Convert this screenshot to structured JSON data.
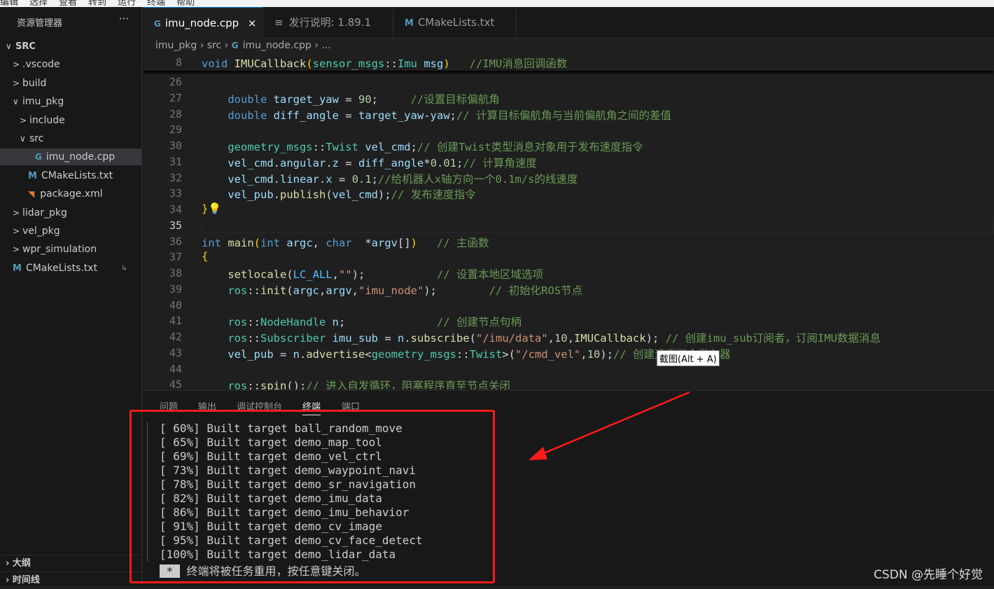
{
  "menu": [
    "编辑",
    "选择",
    "查看",
    "转到",
    "运行",
    "终端",
    "帮助"
  ],
  "sidebar": {
    "title": "资源管理器",
    "more": "···",
    "items": [
      {
        "label": "SRC",
        "depth": 0,
        "type": "root",
        "chev": "∨"
      },
      {
        "label": ".vscode",
        "depth": 1,
        "chev": ">"
      },
      {
        "label": "build",
        "depth": 1,
        "chev": ">"
      },
      {
        "label": "imu_pkg",
        "depth": 1,
        "chev": "∨"
      },
      {
        "label": "include",
        "depth": 2,
        "chev": ">"
      },
      {
        "label": "src",
        "depth": 2,
        "chev": "∨"
      },
      {
        "label": "imu_node.cpp",
        "depth": 3,
        "icon": "cpp",
        "selected": true
      },
      {
        "label": "CMakeLists.txt",
        "depth": 2,
        "icon": "cmake"
      },
      {
        "label": "package.xml",
        "depth": 2,
        "icon": "rss"
      },
      {
        "label": "lidar_pkg",
        "depth": 1,
        "chev": ">"
      },
      {
        "label": "vel_pkg",
        "depth": 1,
        "chev": ">"
      },
      {
        "label": "wpr_simulation",
        "depth": 1,
        "chev": ">"
      },
      {
        "label": "CMakeLists.txt",
        "depth": 1,
        "icon": "cmake",
        "link": "↳"
      }
    ],
    "outline": "大纲",
    "timeline": "时间线"
  },
  "tabs": [
    {
      "label": "imu_node.cpp",
      "icon": "cpp",
      "close": "×",
      "active": true
    },
    {
      "label": "发行说明: 1.89.1",
      "icon": "doc"
    },
    {
      "label": "CMakeLists.txt",
      "icon": "cmake"
    }
  ],
  "breadcrumb": [
    "imu_pkg",
    "src",
    "imu_node.cpp",
    "..."
  ],
  "editor": {
    "sticky": {
      "ln": "8",
      "seg": [
        [
          "void ",
          "k"
        ],
        [
          "IMUCallback",
          "f"
        ],
        [
          "(",
          "p"
        ],
        [
          "sensor_msgs",
          "t"
        ],
        [
          "::",
          "o"
        ],
        [
          "Imu",
          "t"
        ],
        [
          " msg",
          "v"
        ],
        [
          ")",
          "p"
        ],
        [
          "   //IMU消息回调函数",
          "c"
        ]
      ]
    },
    "lines": [
      {
        "ln": "26",
        "seg": []
      },
      {
        "ln": "27",
        "seg": [
          [
            "    double ",
            "k"
          ],
          [
            "target_yaw",
            "v"
          ],
          [
            " = ",
            "o"
          ],
          [
            "90",
            "n"
          ],
          [
            ";     ",
            "o"
          ],
          [
            "//设置目标偏航角",
            "c"
          ]
        ]
      },
      {
        "ln": "28",
        "seg": [
          [
            "    double ",
            "k"
          ],
          [
            "diff_angle",
            "v"
          ],
          [
            " = ",
            "o"
          ],
          [
            "target_yaw",
            "v"
          ],
          [
            "-",
            "o"
          ],
          [
            "yaw",
            "v"
          ],
          [
            ";",
            "o"
          ],
          [
            "// 计算目标偏航角与当前偏航角之间的差值",
            "c"
          ]
        ]
      },
      {
        "ln": "29",
        "seg": []
      },
      {
        "ln": "30",
        "seg": [
          [
            "    geometry_msgs",
            "t"
          ],
          [
            "::",
            "o"
          ],
          [
            "Twist",
            "t"
          ],
          [
            " vel_cmd",
            "v"
          ],
          [
            ";",
            "o"
          ],
          [
            "// 创建Twist类型消息对象用于发布速度指令",
            "c"
          ]
        ]
      },
      {
        "ln": "31",
        "seg": [
          [
            "    vel_cmd",
            "v"
          ],
          [
            ".",
            "o"
          ],
          [
            "angular",
            "v"
          ],
          [
            ".",
            "o"
          ],
          [
            "z",
            "v"
          ],
          [
            " = ",
            "o"
          ],
          [
            "diff_angle",
            "v"
          ],
          [
            "*",
            "o"
          ],
          [
            "0.01",
            "n"
          ],
          [
            ";",
            "o"
          ],
          [
            "// 计算角速度",
            "c"
          ]
        ]
      },
      {
        "ln": "32",
        "seg": [
          [
            "    vel_cmd",
            "v"
          ],
          [
            ".",
            "o"
          ],
          [
            "linear",
            "v"
          ],
          [
            ".",
            "o"
          ],
          [
            "x",
            "v"
          ],
          [
            " = ",
            "o"
          ],
          [
            "0.1",
            "n"
          ],
          [
            ";",
            "o"
          ],
          [
            "//给机器人x轴方向一个0.1m/s的线速度",
            "c"
          ]
        ]
      },
      {
        "ln": "33",
        "seg": [
          [
            "    vel_pub",
            "v"
          ],
          [
            ".",
            "o"
          ],
          [
            "publish",
            "f"
          ],
          [
            "(",
            "o"
          ],
          [
            "vel_cmd",
            "v"
          ],
          [
            ");",
            "o"
          ],
          [
            "// 发布速度指令",
            "c"
          ]
        ]
      },
      {
        "ln": "34",
        "seg": [
          [
            "}",
            "p"
          ],
          [
            "💡",
            "p"
          ]
        ]
      },
      {
        "ln": "35",
        "seg": [],
        "current": true
      },
      {
        "ln": "36",
        "seg": [
          [
            "int ",
            "k"
          ],
          [
            "main",
            "f"
          ],
          [
            "(",
            "p"
          ],
          [
            "int ",
            "k"
          ],
          [
            "argc",
            "v"
          ],
          [
            ", ",
            "o"
          ],
          [
            "char  ",
            "k"
          ],
          [
            "*",
            "o"
          ],
          [
            "argv",
            "v"
          ],
          [
            "[]",
            "o"
          ],
          [
            ")",
            "p"
          ],
          [
            "   // 主函数",
            "c"
          ]
        ]
      },
      {
        "ln": "37",
        "seg": [
          [
            "{",
            "p"
          ]
        ]
      },
      {
        "ln": "38",
        "seg": [
          [
            "    setlocale",
            "f"
          ],
          [
            "(",
            "o"
          ],
          [
            "LC_ALL",
            "m"
          ],
          [
            ",",
            "o"
          ],
          [
            "\"\"",
            "s"
          ],
          [
            ");           ",
            "o"
          ],
          [
            "// 设置本地区域选项",
            "c"
          ]
        ]
      },
      {
        "ln": "39",
        "seg": [
          [
            "    ros",
            "t"
          ],
          [
            "::",
            "o"
          ],
          [
            "init",
            "f"
          ],
          [
            "(",
            "o"
          ],
          [
            "argc",
            "v"
          ],
          [
            ",",
            "o"
          ],
          [
            "argv",
            "v"
          ],
          [
            ",",
            "o"
          ],
          [
            "\"imu_node\"",
            "s"
          ],
          [
            ");        ",
            "o"
          ],
          [
            "// 初始化ROS节点",
            "c"
          ]
        ]
      },
      {
        "ln": "40",
        "seg": []
      },
      {
        "ln": "41",
        "seg": [
          [
            "    ros",
            "t"
          ],
          [
            "::",
            "o"
          ],
          [
            "NodeHandle",
            "t"
          ],
          [
            " n",
            "v"
          ],
          [
            ";              ",
            "o"
          ],
          [
            "// 创建节点句柄",
            "c"
          ]
        ]
      },
      {
        "ln": "42",
        "seg": [
          [
            "    ros",
            "t"
          ],
          [
            "::",
            "o"
          ],
          [
            "Subscriber",
            "t"
          ],
          [
            " imu_sub",
            "v"
          ],
          [
            " = ",
            "o"
          ],
          [
            "n",
            "v"
          ],
          [
            ".",
            "o"
          ],
          [
            "subscribe",
            "f"
          ],
          [
            "(",
            "o"
          ],
          [
            "\"/imu/data\"",
            "s"
          ],
          [
            ",",
            "o"
          ],
          [
            "10",
            "n"
          ],
          [
            ",",
            "o"
          ],
          [
            "IMUCallback",
            "f"
          ],
          [
            "); ",
            "o"
          ],
          [
            "// 创建imu_sub订阅者，订阅IMU数据消息",
            "c"
          ]
        ]
      },
      {
        "ln": "43",
        "seg": [
          [
            "    vel_pub",
            "v"
          ],
          [
            " = ",
            "o"
          ],
          [
            "n",
            "v"
          ],
          [
            ".",
            "o"
          ],
          [
            "advertise",
            "f"
          ],
          [
            "<",
            "o"
          ],
          [
            "geometry_msgs",
            "t"
          ],
          [
            "::",
            "o"
          ],
          [
            "Twist",
            "t"
          ],
          [
            ">",
            "o"
          ],
          [
            "(",
            "o"
          ],
          [
            "\"/cmd_vel\"",
            "s"
          ],
          [
            ",",
            "o"
          ],
          [
            "10",
            "n"
          ],
          [
            ");",
            "o"
          ],
          [
            "// 创建速度指令发布器",
            "c"
          ]
        ]
      },
      {
        "ln": "44",
        "seg": []
      },
      {
        "ln": "45",
        "seg": [
          [
            "    ros",
            "t"
          ],
          [
            "::",
            "o"
          ],
          [
            "spin",
            "f"
          ],
          [
            "();",
            "o"
          ],
          [
            "// 进入自发循环，阻塞程序直至节点关闭",
            "c"
          ]
        ]
      }
    ]
  },
  "tooltip": "截图(Alt + A)",
  "panel": {
    "tabs": [
      "问题",
      "输出",
      "调试控制台",
      "终端",
      "端口"
    ],
    "active": "终端",
    "terminal": [
      "[ 60%] Built target ball_random_move",
      "[ 65%] Built target demo_map_tool",
      "[ 69%] Built target demo_vel_ctrl",
      "[ 73%] Built target demo_waypoint_navi",
      "[ 78%] Built target demo_sr_navigation",
      "[ 82%] Built target demo_imu_data",
      "[ 86%] Built target demo_imu_behavior",
      "[ 91%] Built target demo_cv_image",
      "[ 95%] Built target demo_cv_face_detect",
      "[100%] Built target demo_lidar_data"
    ],
    "final_marker": " * ",
    "final_msg": " 终端将被任务重用，按任意键关闭。"
  },
  "watermark": "CSDN @先睡个好觉",
  "colors": {
    "accent": "#0078d4",
    "annotation": "#ff1a1a"
  }
}
